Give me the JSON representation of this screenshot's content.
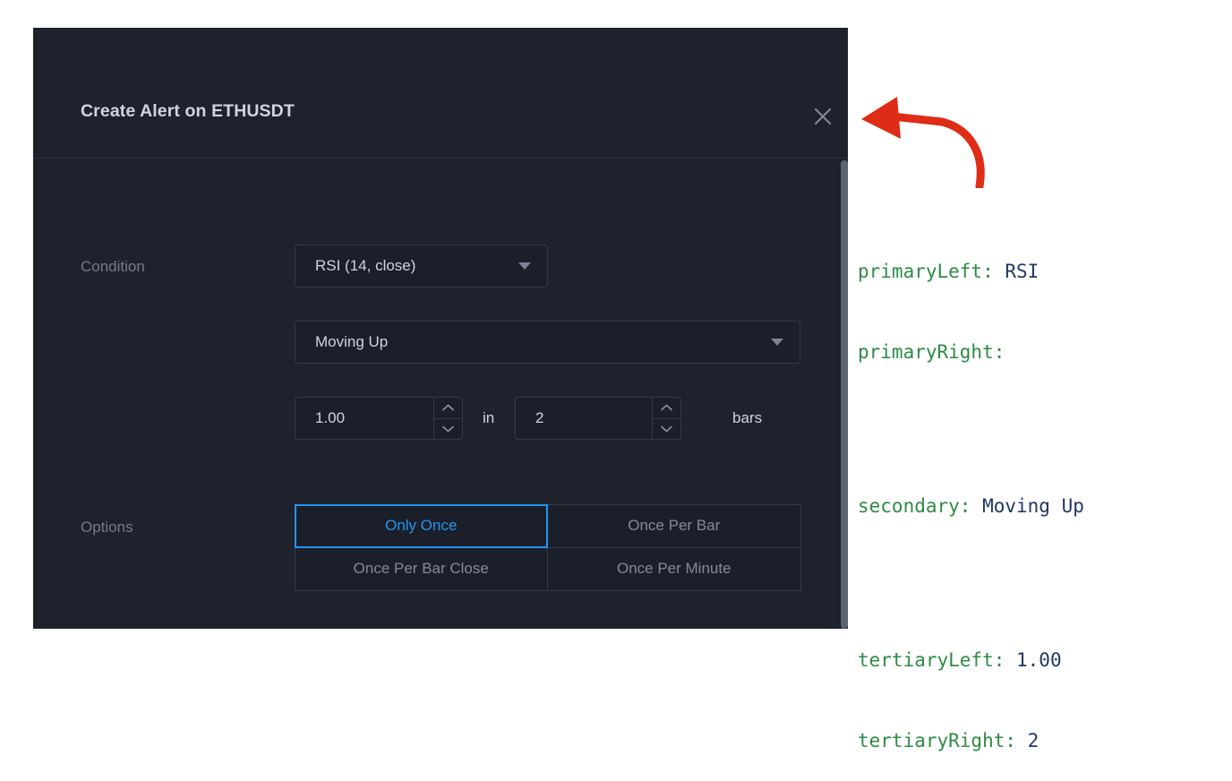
{
  "dialog": {
    "title": "Create Alert on ETHUSDT",
    "close_icon": "close-icon",
    "condition": {
      "label": "Condition",
      "primary_value": "RSI (14, close)",
      "primary_caret_icon": "chevron-down-icon",
      "secondary_value": "Moving Up",
      "secondary_caret_icon": "chevron-down-icon",
      "tertiary_left_value": "1.00",
      "tertiary_right_value": "2",
      "in_word": "in",
      "bars_word": "bars",
      "spinner_up_icon": "chevron-up-icon",
      "spinner_down_icon": "chevron-down-icon"
    },
    "options": {
      "label": "Options",
      "items": [
        {
          "label": "Only Once",
          "selected": true
        },
        {
          "label": "Once Per Bar",
          "selected": false
        },
        {
          "label": "Once Per Bar Close",
          "selected": false
        },
        {
          "label": "Once Per Minute",
          "selected": false
        }
      ]
    },
    "footer": {
      "button_1_label": "",
      "button_2_label": ""
    }
  },
  "annotation": {
    "lines": [
      {
        "key": "primaryLeft: ",
        "value": "RSI"
      },
      {
        "key": "primaryRight: ",
        "value": ""
      },
      {
        "key": "secondary: ",
        "value": "Moving Up"
      },
      {
        "key": "tertiaryLeft: ",
        "value": "1.00"
      },
      {
        "key": "tertiaryRight: ",
        "value": "2"
      }
    ],
    "arrow_icon": "curved-arrow-pointing-left",
    "key_color": "#2e8b46",
    "value_color": "#1f3864",
    "arrow_color": "#de2c17"
  },
  "theme": {
    "dialog_bg": "#1e222d",
    "field_bg": "#1b1f2a",
    "border": "#343a47",
    "text_primary": "#d1d4dc",
    "text_muted": "#787b86",
    "accent_blue": "#2196f3"
  }
}
